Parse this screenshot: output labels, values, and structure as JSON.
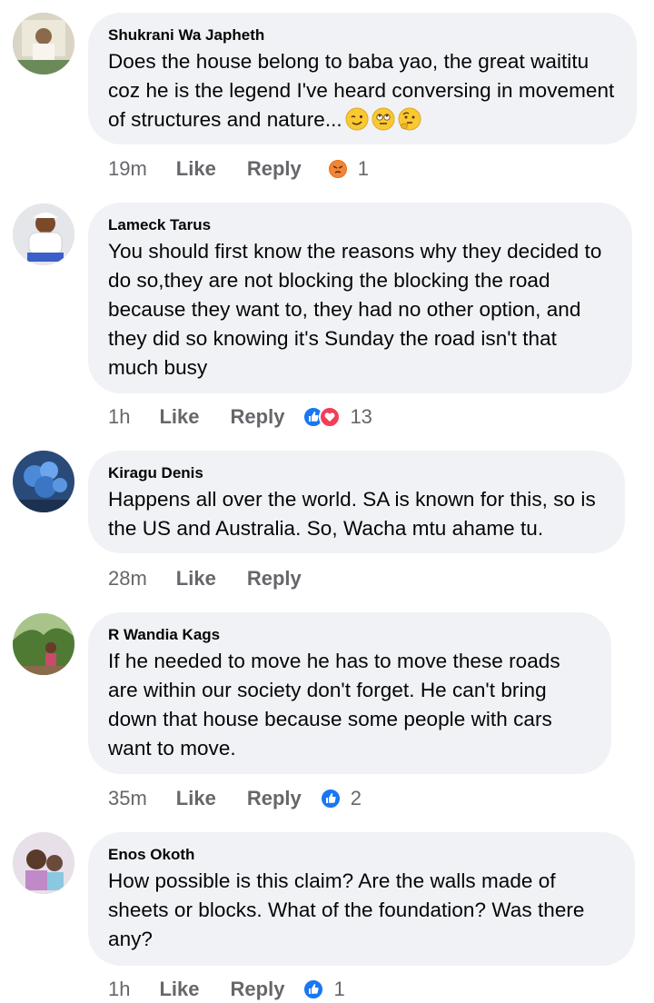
{
  "comments": [
    {
      "author": "Shukrani Wa Japheth",
      "text": "Does the house belong to baba yao, the great waititu coz he is the legend I've heard conversing in movement of structures and  nature...",
      "emojis": [
        "winking-face",
        "face-with-rolling-eyes",
        "thinking-face"
      ],
      "time": "19m",
      "like": "Like",
      "reply": "Reply",
      "reactions": [
        "angry"
      ],
      "reaction_count": "1"
    },
    {
      "author": "Lameck Tarus",
      "text": "You should first know the reasons why they decided to do so,they are not blocking the blocking the road because they want to, they had no other option, and they did so knowing it's Sunday the road isn't that much busy",
      "time": "1h",
      "like": "Like",
      "reply": "Reply",
      "reactions": [
        "like",
        "love"
      ],
      "reaction_count": "13"
    },
    {
      "author": "Kiragu Denis",
      "text": "Happens all over the world. SA is known for this, so is the US and Australia. So, Wacha mtu ahame tu.",
      "time": "28m",
      "like": "Like",
      "reply": "Reply",
      "reactions": [],
      "reaction_count": ""
    },
    {
      "author": "R Wandia Kags",
      "text": "If he needed to move he has to move these roads are within our society don't forget. He can't bring down that house because some people with cars want to move.",
      "time": "35m",
      "like": "Like",
      "reply": "Reply",
      "reactions": [
        "like"
      ],
      "reaction_count": "2"
    },
    {
      "author": "Enos Okoth",
      "text": "How possible is this claim? Are the walls made of sheets or blocks. What of the foundation? Was there any?",
      "time": "1h",
      "like": "Like",
      "reply": "Reply",
      "reactions": [
        "like"
      ],
      "reaction_count": "1"
    }
  ],
  "colors": {
    "bubble": "#f0f2f5",
    "meta_text": "#65676b",
    "like_blue": "#1877f2",
    "love_red": "#f33e58",
    "angry_orange": "#e9710f"
  }
}
